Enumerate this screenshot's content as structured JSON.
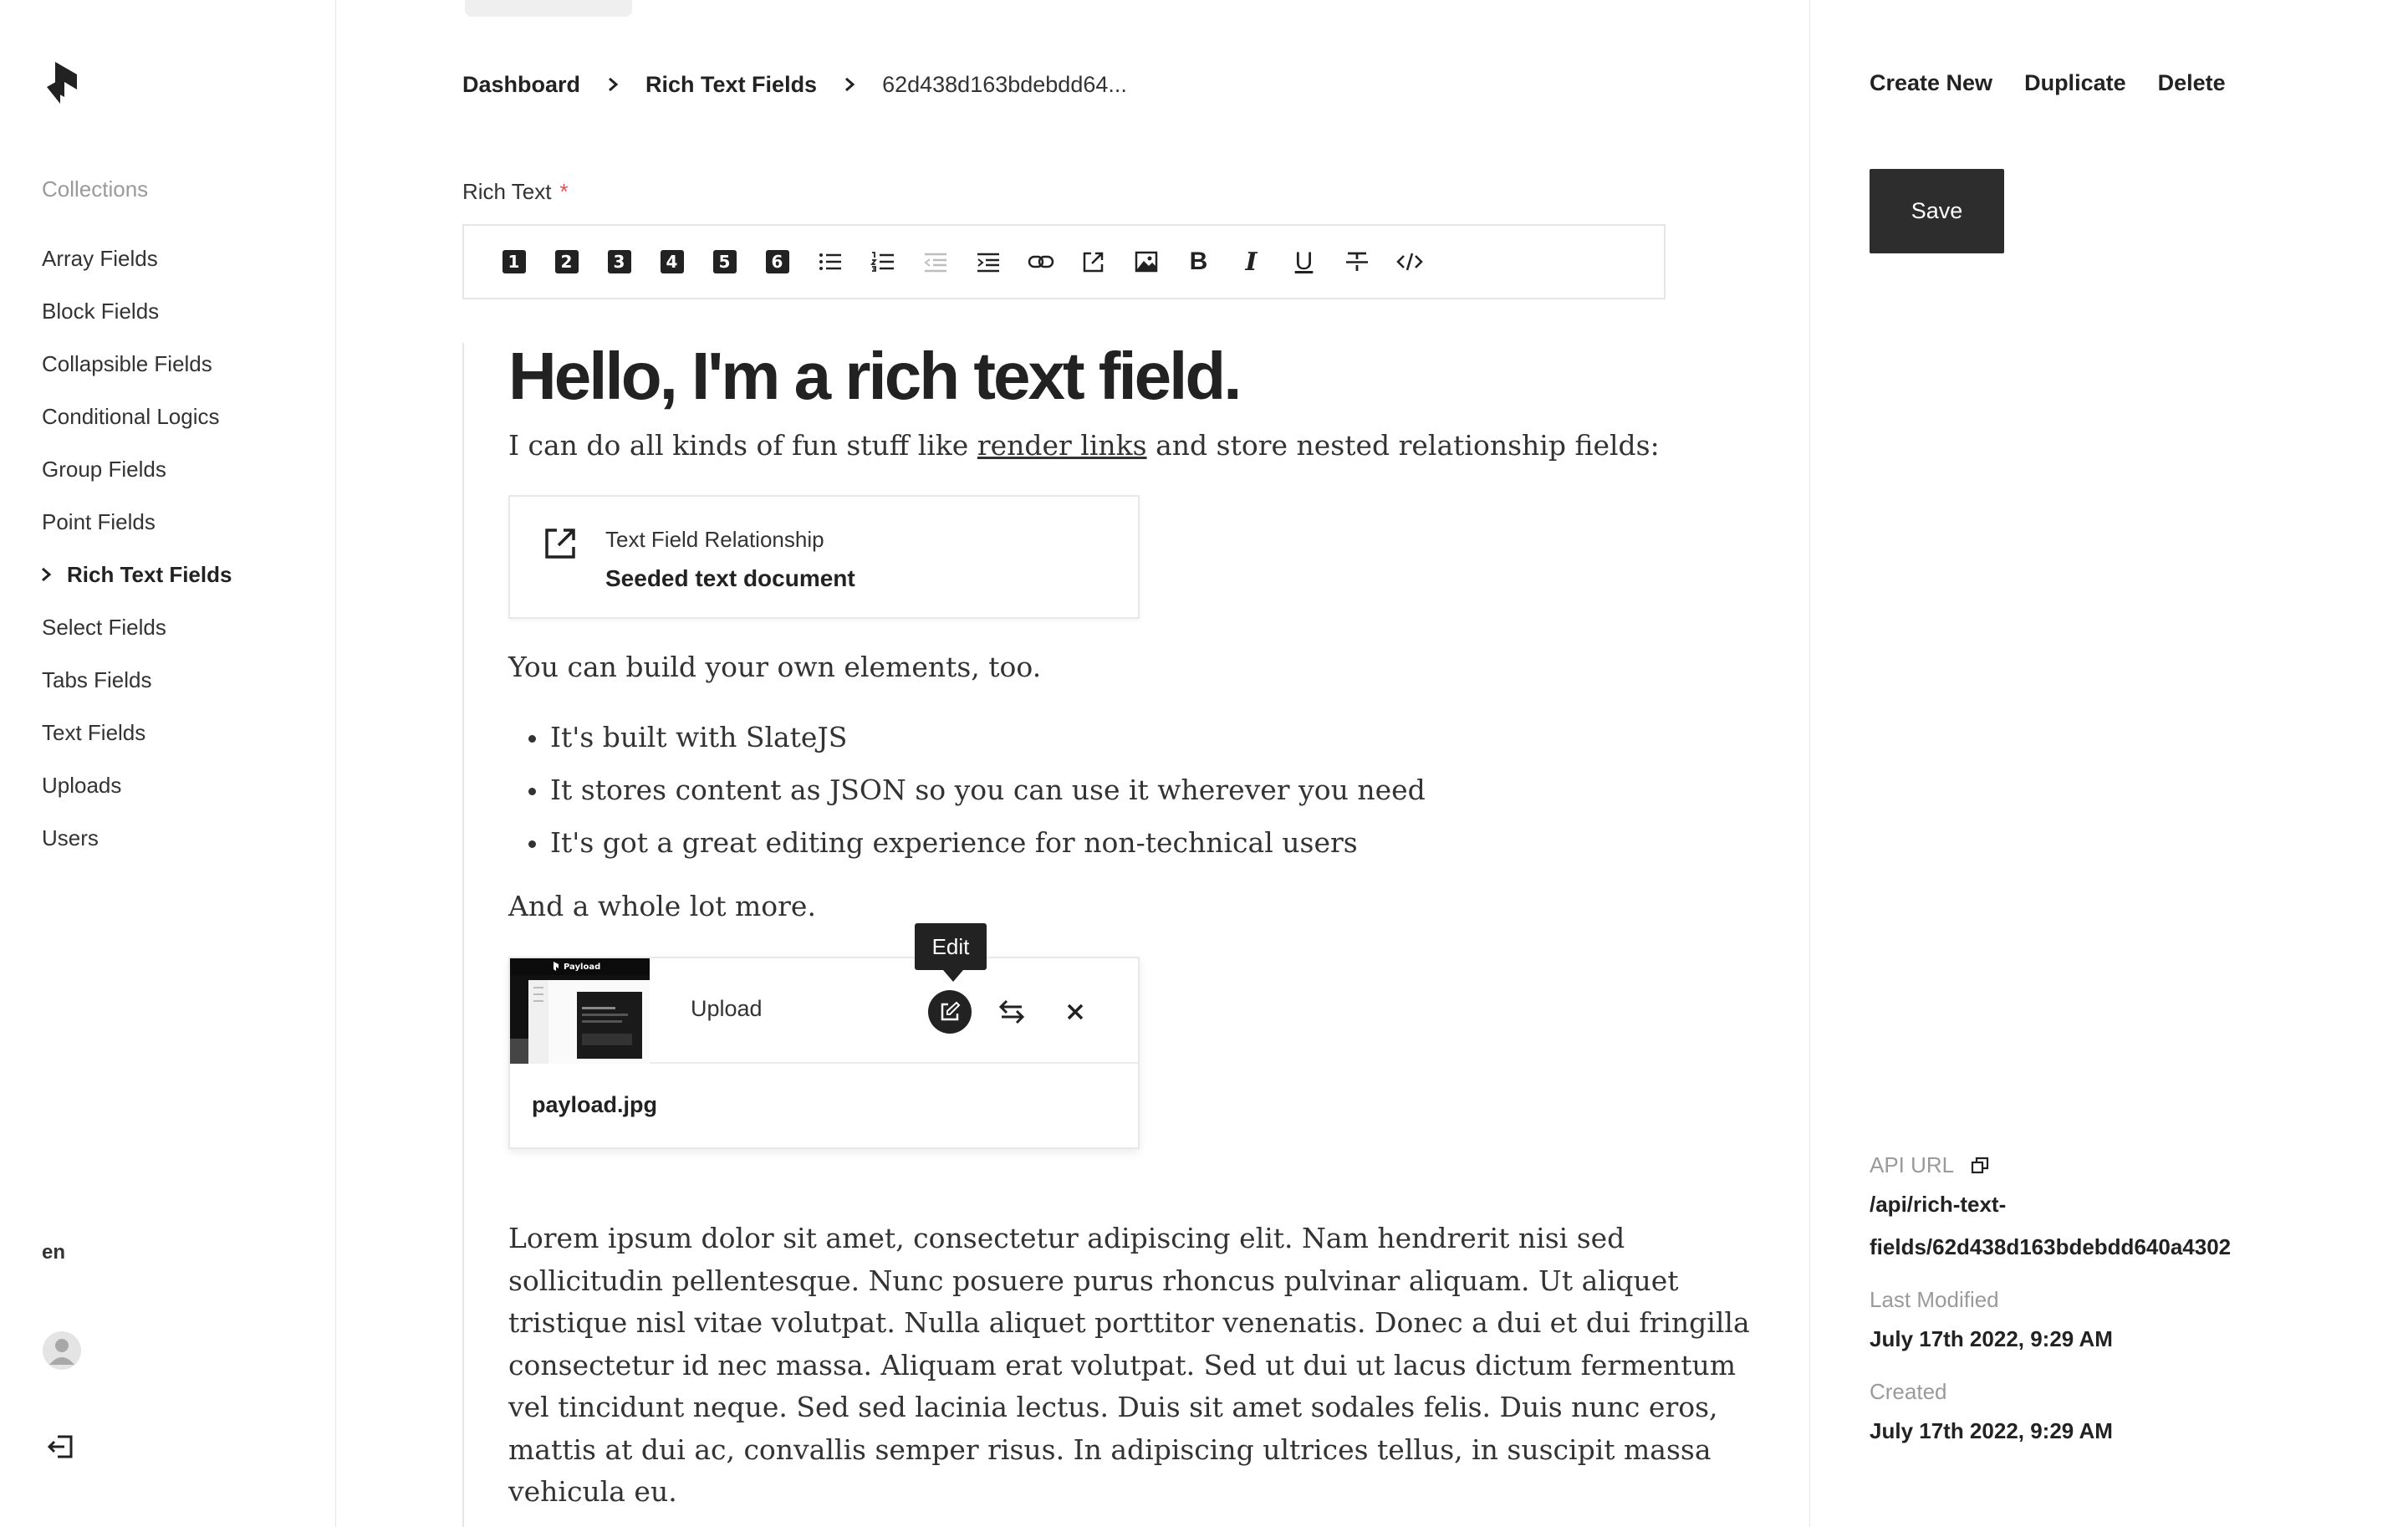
{
  "sidebar": {
    "heading": "Collections",
    "items": [
      {
        "label": "Array Fields"
      },
      {
        "label": "Block Fields"
      },
      {
        "label": "Collapsible Fields"
      },
      {
        "label": "Conditional Logics"
      },
      {
        "label": "Group Fields"
      },
      {
        "label": "Point Fields"
      },
      {
        "label": "Rich Text Fields",
        "active": true
      },
      {
        "label": "Select Fields"
      },
      {
        "label": "Tabs Fields"
      },
      {
        "label": "Text Fields"
      },
      {
        "label": "Uploads"
      },
      {
        "label": "Users"
      }
    ],
    "locale": "en"
  },
  "breadcrumb": {
    "dashboard": "Dashboard",
    "collection": "Rich Text Fields",
    "current": "62d438d163bdebdd64..."
  },
  "field": {
    "label": "Rich Text",
    "required_mark": "*"
  },
  "toolbar": {
    "headings": [
      "1",
      "2",
      "3",
      "4",
      "5",
      "6"
    ],
    "buttons": [
      "unordered-list-icon",
      "ordered-list-icon",
      "outdent-icon",
      "indent-icon",
      "link-icon",
      "relationship-icon",
      "upload-icon",
      "bold-icon",
      "italic-icon",
      "underline-icon",
      "strikethrough-icon",
      "code-icon"
    ],
    "bold_glyph": "B",
    "italic_glyph": "I",
    "underline_glyph": "U"
  },
  "content": {
    "heading": "Hello, I'm a rich text field.",
    "intro_before": "I can do all kinds of fun stuff like ",
    "intro_link": "render links",
    "intro_after": " and store nested relationship fields:",
    "relationship": {
      "label": "Text Field Relationship",
      "value": "Seeded text document"
    },
    "build_text": "You can build your own elements, too.",
    "bullets": [
      "It's built with SlateJS",
      "It stores content as JSON so you can use it wherever you need",
      "It's got a great editing experience for non-technical users"
    ],
    "more_text": "And a whole lot more.",
    "upload": {
      "label": "Upload",
      "tooltip": "Edit",
      "filename": "payload.jpg",
      "thumb_logo": "Payload"
    },
    "lorem_lines": [
      "Lorem ipsum dolor sit amet, consectetur adipiscing elit. Nam hendrerit nisi sed",
      "sollicitudin pellentesque. Nunc posuere purus rhoncus pulvinar aliquam. Ut aliquet",
      "tristique nisl vitae volutpat. Nulla aliquet porttitor venenatis. Donec a dui et dui fringilla",
      "consectetur id nec massa. Aliquam erat volutpat. Sed ut dui ut lacus dictum fermentum",
      "vel tincidunt neque. Sed sed lacinia lectus. Duis sit amet sodales felis. Duis nunc eros,",
      "mattis at dui ac, convallis semper risus. In adipiscing ultrices tellus, in suscipit massa",
      "vehicula eu."
    ]
  },
  "right": {
    "create_new": "Create New",
    "duplicate": "Duplicate",
    "delete": "Delete",
    "save": "Save",
    "api_url_label": "API URL",
    "api_url_line1": "/api/rich-text-",
    "api_url_line2": "fields/62d438d163bdebdd640a4302",
    "last_modified_label": "Last Modified",
    "last_modified_value": "July 17th 2022, 9:29 AM",
    "created_label": "Created",
    "created_value": "July 17th 2022, 9:29 AM"
  },
  "colors": {
    "accent_dark": "#222222",
    "required": "#e05252",
    "muted": "#9a9a9a",
    "border": "#e8e8e8"
  }
}
